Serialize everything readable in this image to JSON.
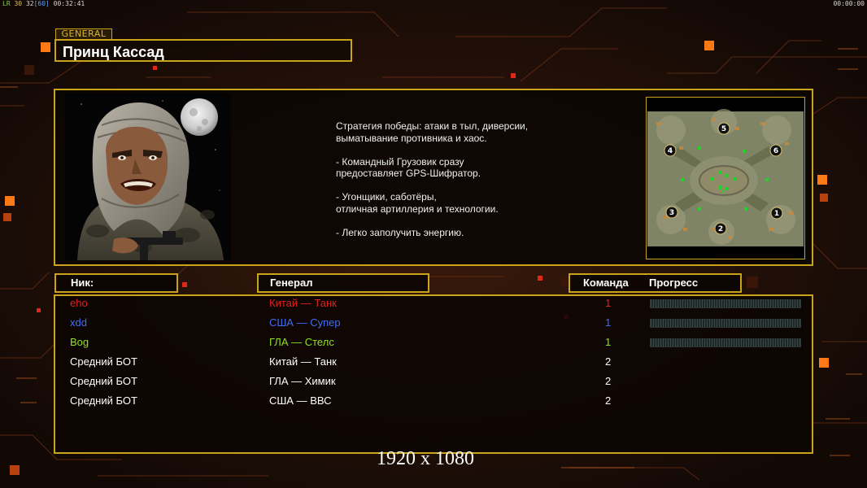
{
  "hud": {
    "left_prefix": "LR",
    "fps": "30",
    "limit": "32",
    "max": "[60]",
    "time_left": "00:32:41",
    "time_right": "00:00:00"
  },
  "general_tag": "GENERAL",
  "general_name": "Принц Кассад",
  "description": [
    "Стратегия победы: атаки в тыл, диверсии,\n выматывание противника и хаос.",
    "- Командный Грузовик сразу\nпредоставляет GPS-Шифратор.",
    "- Угонщики, саботёры,\nотличная артиллерия и технологии.",
    "- Легко заполучить энергию."
  ],
  "map": {
    "start_positions": [
      "1",
      "2",
      "3",
      "4",
      "5",
      "6"
    ]
  },
  "headers": {
    "nick": "Ник:",
    "general": "Генерал",
    "team": "Команда",
    "progress": "Прогресс"
  },
  "players": [
    {
      "nick": "eho",
      "general": "Китай — Танк",
      "team": "1",
      "color": "#e02020",
      "team_color": "#e02020",
      "has_progress": true
    },
    {
      "nick": "xdd",
      "general": "США — Супер",
      "team": "1",
      "color": "#3f6df2",
      "team_color": "#3f6df2",
      "has_progress": true
    },
    {
      "nick": "Bog",
      "general": "ГЛА — Стелс",
      "team": "1",
      "color": "#8fe21a",
      "team_color": "#8fe21a",
      "has_progress": true
    },
    {
      "nick": "Средний БОТ",
      "general": "Китай — Танк",
      "team": "2",
      "color": "#ffffff",
      "team_color": "#ffffff",
      "has_progress": false
    },
    {
      "nick": "Средний БОТ",
      "general": "ГЛА — Химик",
      "team": "2",
      "color": "#ffffff",
      "team_color": "#ffffff",
      "has_progress": false
    },
    {
      "nick": "Средний БОТ",
      "general": "США — ВВС",
      "team": "2",
      "color": "#ffffff",
      "team_color": "#ffffff",
      "has_progress": false
    }
  ],
  "resolution_label": "1920 x 1080",
  "colors": {
    "frame": "#c9a31a",
    "accent": "#ff8a1a",
    "background": "#1a0e09"
  }
}
